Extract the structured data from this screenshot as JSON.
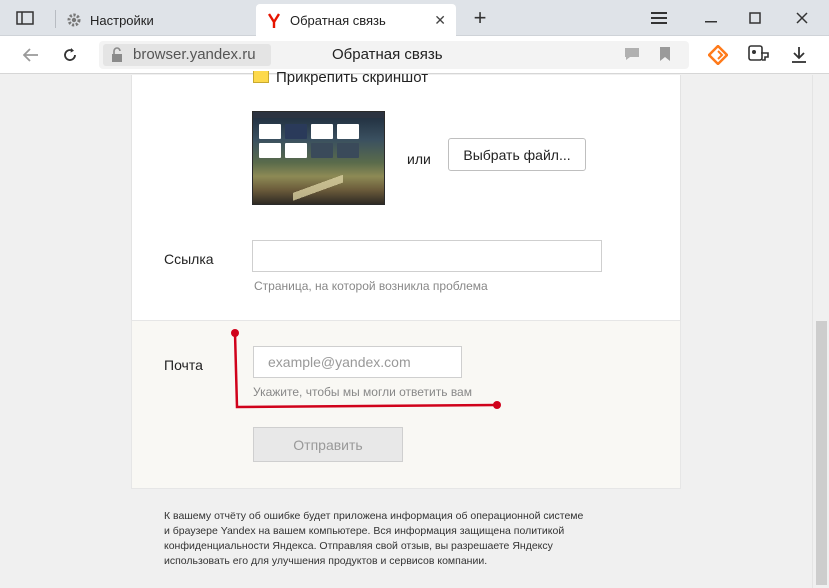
{
  "tabs": {
    "inactive_label": "Настройки",
    "active_label": "Обратная связь"
  },
  "address_bar": {
    "domain": "browser.yandex.ru",
    "page_title": "Обратная связь"
  },
  "form": {
    "attach_screenshot_label": "Прикрепить скриншот",
    "attach_checked": true,
    "or_text": "или",
    "choose_file_button": "Выбрать файл...",
    "link_label": "Ссылка",
    "link_value": "",
    "link_hint": "Страница, на которой возникла проблема",
    "email_label": "Почта",
    "email_placeholder": "example@yandex.com",
    "email_hint": "Укажите, чтобы мы могли ответить вам",
    "submit_button": "Отправить"
  },
  "footnote": {
    "line1": "К вашему отчёту об ошибке будет приложена информация об операционной системе",
    "line2": "и браузере Yandex на вашем компьютере. Вся информация защищена политикой",
    "line3": "конфиденциальности Яндекса. Отправляя свой отзыв, вы разрешаете Яндексу",
    "line4": "использовать его для улучшения продуктов и сервисов компании."
  },
  "colors": {
    "annotation_red": "#d0021b",
    "checkbox_yellow": "#fdd94b",
    "yandex_red": "#e61400",
    "alice_orange": "#ff7a1a"
  },
  "icons": {
    "sidebar": "sidebar-toggle-icon",
    "settings": "gear-icon",
    "new_tab": "plus-icon",
    "menu": "hamburger-icon",
    "bookmark": "bookmark-icon",
    "downloads": "download-icon"
  }
}
